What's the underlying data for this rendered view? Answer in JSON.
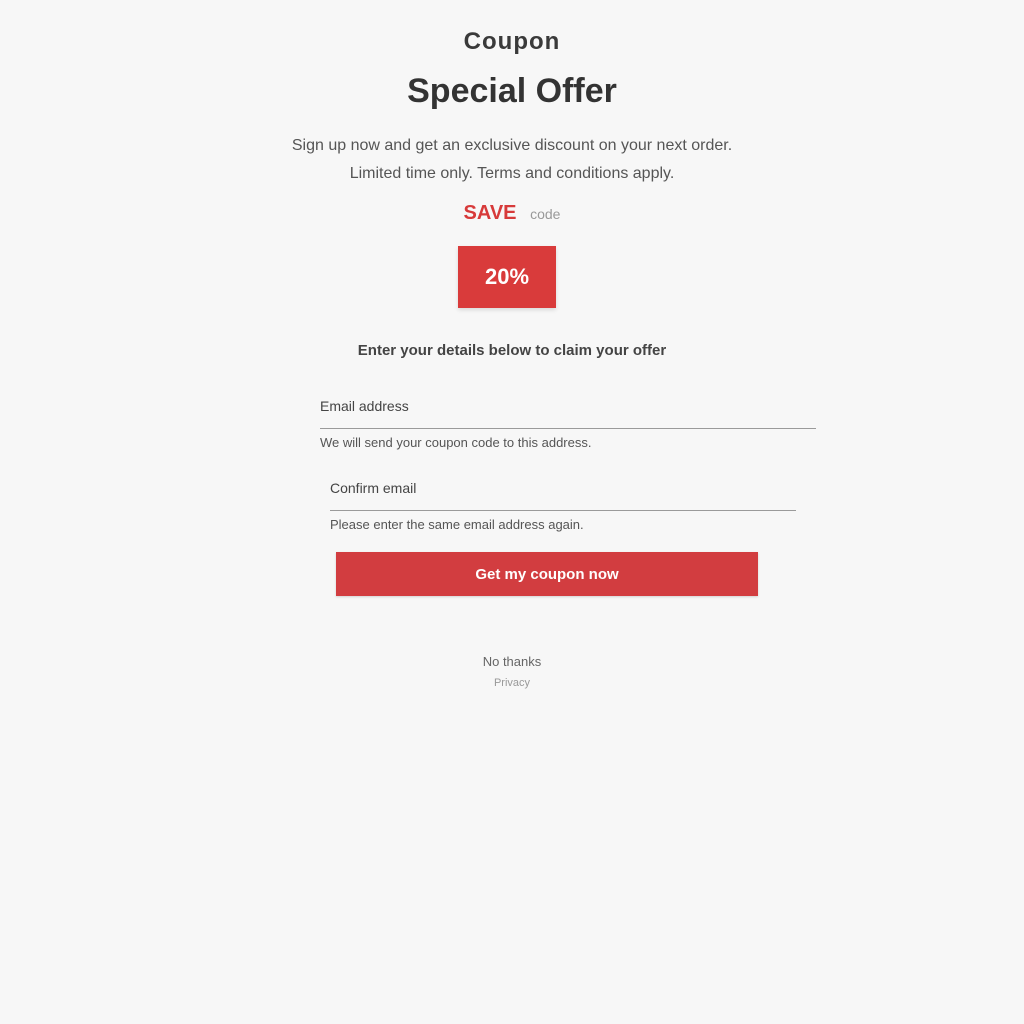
{
  "header": {
    "eyebrow": "Coupon",
    "title": "Special Offer"
  },
  "intro": {
    "line1": "Sign up now and get an exclusive discount on your next order.",
    "line2": "Limited time only. Terms and conditions apply."
  },
  "promo": {
    "code": "SAVE",
    "note": "code"
  },
  "stamp": {
    "label": "20%"
  },
  "subhead": "Enter your details below to claim your offer",
  "form": {
    "field1_label": "Email address",
    "field1_hint": "We will send your coupon code to this address.",
    "field2_label": "Confirm email",
    "field2_hint": "Please enter the same email address again."
  },
  "cta": {
    "label": "Get my coupon now"
  },
  "footer": {
    "line1": "No thanks",
    "line2": "Privacy"
  },
  "colors": {
    "accent": "#d23d40",
    "background": "#f7f7f7"
  }
}
